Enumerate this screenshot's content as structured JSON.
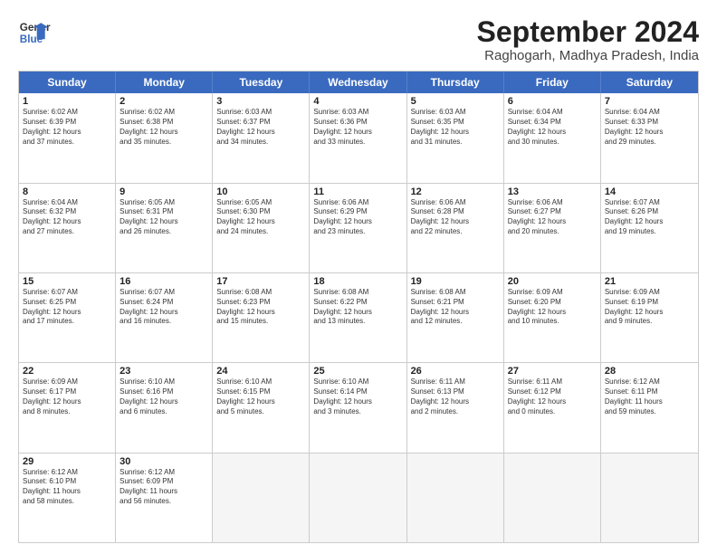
{
  "header": {
    "logo_line1": "General",
    "logo_line2": "Blue",
    "month": "September 2024",
    "location": "Raghogarh, Madhya Pradesh, India"
  },
  "weekdays": [
    "Sunday",
    "Monday",
    "Tuesday",
    "Wednesday",
    "Thursday",
    "Friday",
    "Saturday"
  ],
  "rows": [
    [
      {
        "day": "",
        "empty": true
      },
      {
        "day": "2",
        "lines": [
          "Sunrise: 6:02 AM",
          "Sunset: 6:38 PM",
          "Daylight: 12 hours",
          "and 35 minutes."
        ]
      },
      {
        "day": "3",
        "lines": [
          "Sunrise: 6:03 AM",
          "Sunset: 6:37 PM",
          "Daylight: 12 hours",
          "and 34 minutes."
        ]
      },
      {
        "day": "4",
        "lines": [
          "Sunrise: 6:03 AM",
          "Sunset: 6:36 PM",
          "Daylight: 12 hours",
          "and 33 minutes."
        ]
      },
      {
        "day": "5",
        "lines": [
          "Sunrise: 6:03 AM",
          "Sunset: 6:35 PM",
          "Daylight: 12 hours",
          "and 31 minutes."
        ]
      },
      {
        "day": "6",
        "lines": [
          "Sunrise: 6:04 AM",
          "Sunset: 6:34 PM",
          "Daylight: 12 hours",
          "and 30 minutes."
        ]
      },
      {
        "day": "7",
        "lines": [
          "Sunrise: 6:04 AM",
          "Sunset: 6:33 PM",
          "Daylight: 12 hours",
          "and 29 minutes."
        ]
      }
    ],
    [
      {
        "day": "8",
        "lines": [
          "Sunrise: 6:04 AM",
          "Sunset: 6:32 PM",
          "Daylight: 12 hours",
          "and 27 minutes."
        ]
      },
      {
        "day": "9",
        "lines": [
          "Sunrise: 6:05 AM",
          "Sunset: 6:31 PM",
          "Daylight: 12 hours",
          "and 26 minutes."
        ]
      },
      {
        "day": "10",
        "lines": [
          "Sunrise: 6:05 AM",
          "Sunset: 6:30 PM",
          "Daylight: 12 hours",
          "and 24 minutes."
        ]
      },
      {
        "day": "11",
        "lines": [
          "Sunrise: 6:06 AM",
          "Sunset: 6:29 PM",
          "Daylight: 12 hours",
          "and 23 minutes."
        ]
      },
      {
        "day": "12",
        "lines": [
          "Sunrise: 6:06 AM",
          "Sunset: 6:28 PM",
          "Daylight: 12 hours",
          "and 22 minutes."
        ]
      },
      {
        "day": "13",
        "lines": [
          "Sunrise: 6:06 AM",
          "Sunset: 6:27 PM",
          "Daylight: 12 hours",
          "and 20 minutes."
        ]
      },
      {
        "day": "14",
        "lines": [
          "Sunrise: 6:07 AM",
          "Sunset: 6:26 PM",
          "Daylight: 12 hours",
          "and 19 minutes."
        ]
      }
    ],
    [
      {
        "day": "15",
        "lines": [
          "Sunrise: 6:07 AM",
          "Sunset: 6:25 PM",
          "Daylight: 12 hours",
          "and 17 minutes."
        ]
      },
      {
        "day": "16",
        "lines": [
          "Sunrise: 6:07 AM",
          "Sunset: 6:24 PM",
          "Daylight: 12 hours",
          "and 16 minutes."
        ]
      },
      {
        "day": "17",
        "lines": [
          "Sunrise: 6:08 AM",
          "Sunset: 6:23 PM",
          "Daylight: 12 hours",
          "and 15 minutes."
        ]
      },
      {
        "day": "18",
        "lines": [
          "Sunrise: 6:08 AM",
          "Sunset: 6:22 PM",
          "Daylight: 12 hours",
          "and 13 minutes."
        ]
      },
      {
        "day": "19",
        "lines": [
          "Sunrise: 6:08 AM",
          "Sunset: 6:21 PM",
          "Daylight: 12 hours",
          "and 12 minutes."
        ]
      },
      {
        "day": "20",
        "lines": [
          "Sunrise: 6:09 AM",
          "Sunset: 6:20 PM",
          "Daylight: 12 hours",
          "and 10 minutes."
        ]
      },
      {
        "day": "21",
        "lines": [
          "Sunrise: 6:09 AM",
          "Sunset: 6:19 PM",
          "Daylight: 12 hours",
          "and 9 minutes."
        ]
      }
    ],
    [
      {
        "day": "22",
        "lines": [
          "Sunrise: 6:09 AM",
          "Sunset: 6:17 PM",
          "Daylight: 12 hours",
          "and 8 minutes."
        ]
      },
      {
        "day": "23",
        "lines": [
          "Sunrise: 6:10 AM",
          "Sunset: 6:16 PM",
          "Daylight: 12 hours",
          "and 6 minutes."
        ]
      },
      {
        "day": "24",
        "lines": [
          "Sunrise: 6:10 AM",
          "Sunset: 6:15 PM",
          "Daylight: 12 hours",
          "and 5 minutes."
        ]
      },
      {
        "day": "25",
        "lines": [
          "Sunrise: 6:10 AM",
          "Sunset: 6:14 PM",
          "Daylight: 12 hours",
          "and 3 minutes."
        ]
      },
      {
        "day": "26",
        "lines": [
          "Sunrise: 6:11 AM",
          "Sunset: 6:13 PM",
          "Daylight: 12 hours",
          "and 2 minutes."
        ]
      },
      {
        "day": "27",
        "lines": [
          "Sunrise: 6:11 AM",
          "Sunset: 6:12 PM",
          "Daylight: 12 hours",
          "and 0 minutes."
        ]
      },
      {
        "day": "28",
        "lines": [
          "Sunrise: 6:12 AM",
          "Sunset: 6:11 PM",
          "Daylight: 11 hours",
          "and 59 minutes."
        ]
      }
    ],
    [
      {
        "day": "29",
        "lines": [
          "Sunrise: 6:12 AM",
          "Sunset: 6:10 PM",
          "Daylight: 11 hours",
          "and 58 minutes."
        ]
      },
      {
        "day": "30",
        "lines": [
          "Sunrise: 6:12 AM",
          "Sunset: 6:09 PM",
          "Daylight: 11 hours",
          "and 56 minutes."
        ]
      },
      {
        "day": "",
        "empty": true
      },
      {
        "day": "",
        "empty": true
      },
      {
        "day": "",
        "empty": true
      },
      {
        "day": "",
        "empty": true
      },
      {
        "day": "",
        "empty": true
      }
    ]
  ],
  "row0_sunday": {
    "day": "1",
    "lines": [
      "Sunrise: 6:02 AM",
      "Sunset: 6:39 PM",
      "Daylight: 12 hours",
      "and 37 minutes."
    ]
  }
}
